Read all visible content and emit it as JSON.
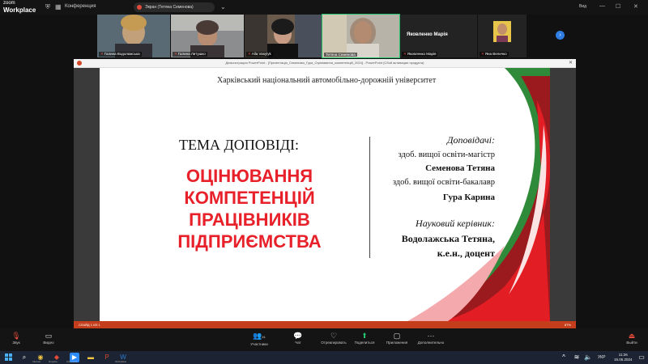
{
  "app": {
    "brand_small": "zoom",
    "brand_big": "Workplace",
    "conference_label": "Конференция",
    "share_label": "Экран (Тетяна Семенова)",
    "user_label": "Вид"
  },
  "participants": [
    {
      "name": "Галина Водолажська",
      "muted": true
    },
    {
      "name": "Галина Литушко",
      "muted": true
    },
    {
      "name": "Alla Vasylyk",
      "muted": true
    },
    {
      "name": "Тетяна Семенова",
      "muted": false
    },
    {
      "name": "Яковленко Марія",
      "muted": true,
      "label": "Яковленко Марія"
    },
    {
      "name": "Яна Величко",
      "muted": true
    }
  ],
  "ppt": {
    "window_title": "Демонстрация PowerPoint - [Презентація_Семенова_Гура_Оцінювання_компетенцій_2024] - PowerPoint (Сбой активации продукта)",
    "status_left": "СЛАЙД 1 ИЗ 1",
    "status_right": "87%"
  },
  "slide": {
    "university": "Харківський національний автомобільно-дорожній університет",
    "topic_label": "ТЕМА ДОПОВІДІ:",
    "title_lines": [
      "ОЦІНЮВАННЯ",
      "КОМПЕТЕНЦІЙ",
      "ПРАЦІВНИКІВ",
      "ПІДПРИЄМСТВА"
    ],
    "speakers_label": "Доповідачі",
    "speakers_colon": ":",
    "speaker1_degree": "здоб. вищої освіти-магістр",
    "speaker1_name": "Семенова Тетяна",
    "speaker2_degree": "здоб. вищої освіти-бакалавр",
    "speaker2_name": "Гура Карина",
    "supervisor_label": "Науковий керівник:",
    "supervisor_name": "Водолажська Тетяна,",
    "supervisor_title": "к.е.н., доцент"
  },
  "toolbar": {
    "audio": "Звук",
    "video": "Видео",
    "participants": "Участники",
    "participants_count": "41",
    "chat": "Чат",
    "reactions": "Отреагировать",
    "share": "Поделиться",
    "record": "Приложения",
    "more": "Дополнительно",
    "leave": "Выйти"
  },
  "taskbar": {
    "labels": [
      "Internet",
      "Dopoвн..",
      "Zoom.exe",
      "Workplace"
    ],
    "lang": "УКР",
    "time": "11:26",
    "date": "15.05.2024"
  },
  "colors": {
    "accent_red": "#e8202a",
    "ppt_orange": "#c43e1c",
    "zoom_green": "#23c16b"
  }
}
